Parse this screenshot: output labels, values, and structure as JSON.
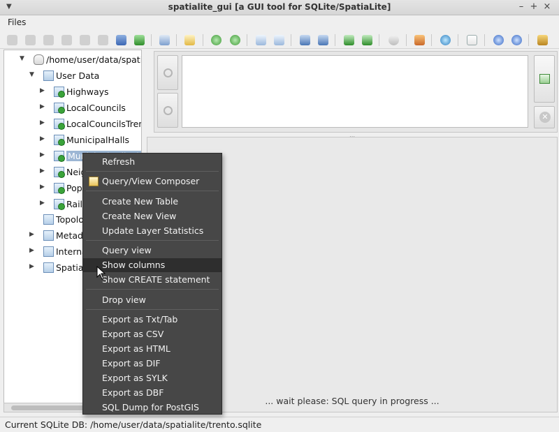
{
  "window": {
    "title": "spatialite_gui     [a GUI tool for SQLite/SpatiaLite]",
    "minimize": "–",
    "maximize": "+",
    "close": "×"
  },
  "menubar": {
    "files": "Files"
  },
  "tree": {
    "root": "/home/user/data/spatialite",
    "user_data": "User Data",
    "items": [
      "Highways",
      "LocalCouncils",
      "LocalCouncilsTrento",
      "MunicipalHalls",
      "MunicipalHallsView",
      "Neighbourhoods",
      "PopulatedPlaces",
      "Railways"
    ],
    "topology": "Topology",
    "metadata": "Metadata",
    "internal": "Internal",
    "spatialite": "Spatialite"
  },
  "context_menu": {
    "refresh": "Refresh",
    "query_view_composer": "Query/View Composer",
    "create_new_table": "Create New Table",
    "create_new_view": "Create New View",
    "update_layer_statistics": "Update Layer Statistics",
    "query_view": "Query view",
    "show_columns": "Show columns",
    "show_create_statement": "Show CREATE statement",
    "drop_view": "Drop view",
    "export_txt": "Export as Txt/Tab",
    "export_csv": "Export as CSV",
    "export_html": "Export as HTML",
    "export_dif": "Export as DIF",
    "export_sylk": "Export as SYLK",
    "export_dbf": "Export as DBF",
    "sql_dump": "SQL Dump for PostGIS"
  },
  "results": {
    "wait_message": "... wait please: SQL query in progress ..."
  },
  "statusbar": {
    "text": "Current SQLite DB: /home/user/data/spatialite/trento.sqlite"
  },
  "colors": {
    "menu_bg": "#474747",
    "menu_hover": "#2e2e2e",
    "selection": "#9cb6d4"
  }
}
